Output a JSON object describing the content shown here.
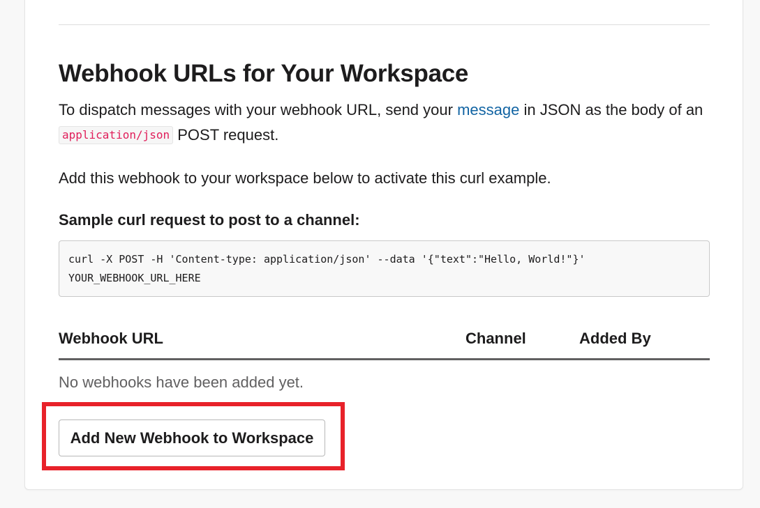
{
  "section": {
    "title": "Webhook URLs for Your Workspace",
    "intro_prefix": "To dispatch messages with your webhook URL, send your ",
    "intro_link": "message",
    "intro_middle": " in JSON as the body of an ",
    "intro_code": "application/json",
    "intro_suffix": " POST request.",
    "activate_note": "Add this webhook to your workspace below to activate this curl example.",
    "sample_heading": "Sample curl request to post to a channel:",
    "curl_line1": "curl -X POST -H 'Content-type: application/json' --data '{\"text\":\"Hello, World!\"}'",
    "curl_line2": "YOUR_WEBHOOK_URL_HERE"
  },
  "table": {
    "columns": [
      "Webhook URL",
      "Channel",
      "Added By"
    ],
    "empty_text": "No webhooks have been added yet."
  },
  "actions": {
    "add_button_label": "Add New Webhook to Workspace"
  },
  "colors": {
    "link": "#1264a3",
    "inline_code": "#e01e5a",
    "highlight": "#e8222a"
  }
}
